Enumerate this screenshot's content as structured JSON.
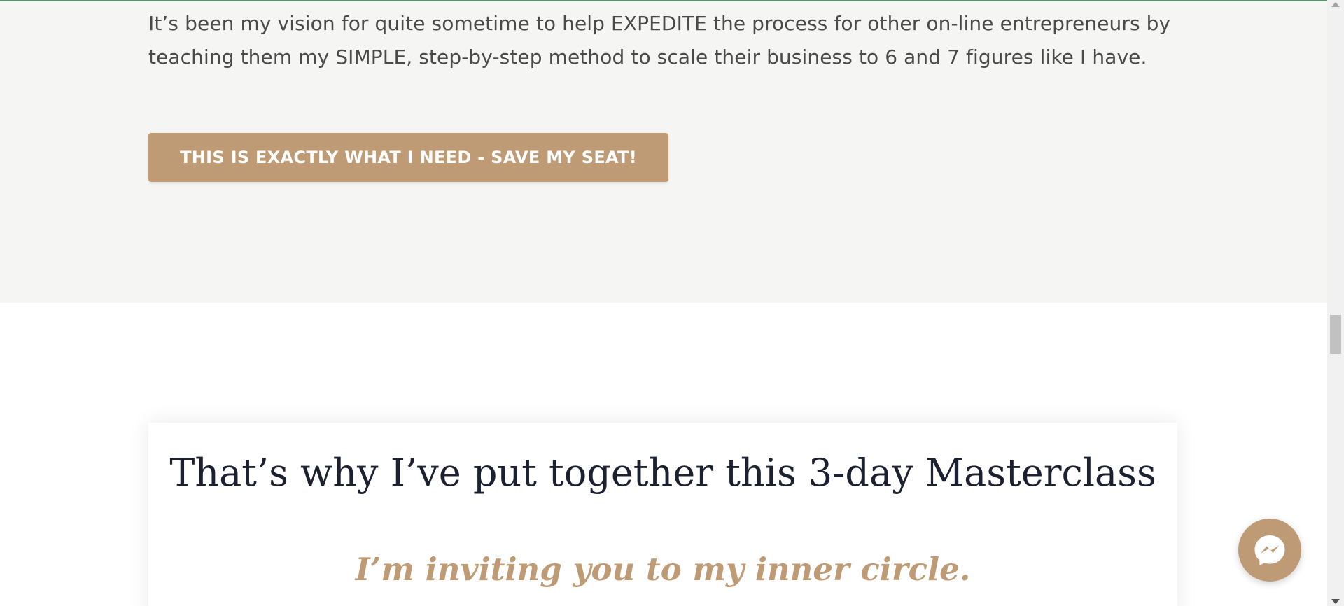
{
  "intro": {
    "text": "It’s been my vision for quite sometime to help EXPEDITE the process for other on-line entrepreneurs by teaching them my SIMPLE, step-by-step method to scale their business to 6 and 7 figures like I have."
  },
  "cta": {
    "label": "THIS IS EXACTLY WHAT I NEED - SAVE MY SEAT!"
  },
  "masterclass": {
    "heading": "That’s why I’ve put together this 3-day Masterclass",
    "subheading": "I’m inviting you to my inner circle."
  },
  "chat_widget": {
    "icon": "messenger-icon"
  },
  "colors": {
    "accent": "#be9b74",
    "heading": "#1b2130",
    "body_text": "#4a4a4a",
    "section_gray": "#f5f5f3"
  }
}
